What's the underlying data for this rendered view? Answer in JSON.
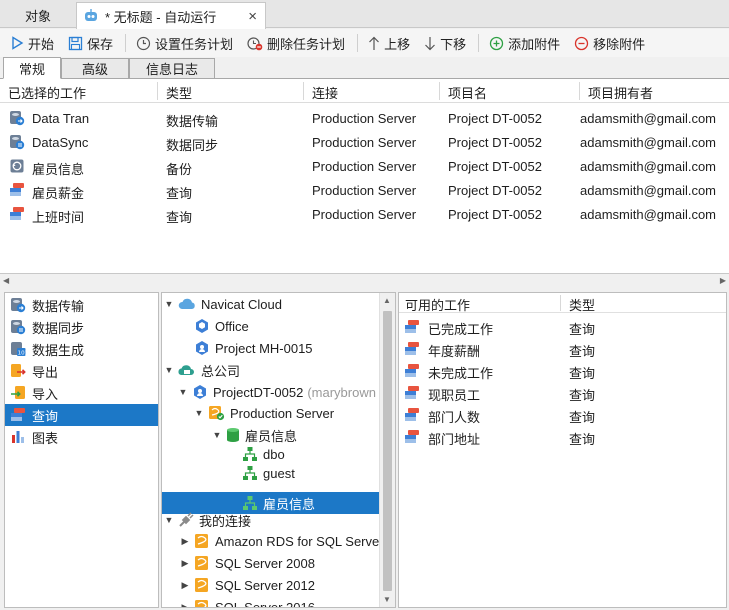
{
  "tabs": {
    "objects": "对象",
    "document": "* 无标题 - 自动运行",
    "close": "×"
  },
  "toolbar": {
    "start": "开始",
    "save": "保存",
    "set_schedule": "设置任务计划",
    "delete_schedule": "删除任务计划",
    "move_up": "上移",
    "move_down": "下移",
    "add_attachment": "添加附件",
    "remove_attachment": "移除附件"
  },
  "subtabs": [
    "常规",
    "高级",
    "信息日志"
  ],
  "jobs": {
    "columns": [
      "已选择的工作",
      "类型",
      "连接",
      "项目名",
      "项目拥有者"
    ],
    "rows": [
      {
        "name": "Data Tran",
        "type": "数据传输",
        "connection": "Production Server",
        "project": "Project DT-0052",
        "owner": "adamsmith@gmail.com",
        "icon": "data-transfer-icon"
      },
      {
        "name": "DataSync",
        "type": "数据同步",
        "connection": "Production Server",
        "project": "Project DT-0052",
        "owner": "adamsmith@gmail.com",
        "icon": "data-sync-icon"
      },
      {
        "name": "雇员信息",
        "type": "备份",
        "connection": "Production Server",
        "project": "Project DT-0052",
        "owner": "adamsmith@gmail.com",
        "icon": "backup-icon"
      },
      {
        "name": "雇员薪金",
        "type": "查询",
        "connection": "Production Server",
        "project": "Project DT-0052",
        "owner": "adamsmith@gmail.com",
        "icon": "query-icon"
      },
      {
        "name": "上班时间",
        "type": "查询",
        "connection": "Production Server",
        "project": "Project DT-0052",
        "owner": "adamsmith@gmail.com",
        "icon": "query-icon"
      }
    ]
  },
  "categories": [
    {
      "label": "数据传输",
      "icon": "data-transfer-icon"
    },
    {
      "label": "数据同步",
      "icon": "data-sync-icon"
    },
    {
      "label": "数据生成",
      "icon": "data-generation-icon"
    },
    {
      "label": "导出",
      "icon": "export-icon"
    },
    {
      "label": "导入",
      "icon": "import-icon"
    },
    {
      "label": "查询",
      "icon": "query-icon",
      "selected": true
    },
    {
      "label": "图表",
      "icon": "chart-icon"
    }
  ],
  "tree": {
    "navicat_cloud": "Navicat Cloud",
    "office": "Office",
    "project_mh": "Project MH-0015",
    "company": "总公司",
    "project_dt": "ProjectDT-0052",
    "project_dt_owner": "(marybrown",
    "production_server": "Production Server",
    "db_employee": "雇员信息",
    "schema_dbo": "dbo",
    "schema_guest": "guest",
    "schema_employee": "雇员信息",
    "my_connections": "我的连接",
    "conn1": "Amazon RDS for SQL Server",
    "conn2": "SQL Server 2008",
    "conn3": "SQL Server 2012",
    "conn4": "SQL Server 2016"
  },
  "available": {
    "columns": [
      "可用的工作",
      "类型"
    ],
    "rows": [
      {
        "name": "已完成工作",
        "type": "查询"
      },
      {
        "name": "年度薪酬",
        "type": "查询"
      },
      {
        "name": "未完成工作",
        "type": "查询"
      },
      {
        "name": "现职员工",
        "type": "查询"
      },
      {
        "name": "部门人数",
        "type": "查询"
      },
      {
        "name": "部门地址",
        "type": "查询"
      }
    ]
  },
  "colors": {
    "selection": "#1c78c7",
    "accent_green": "#2ea043",
    "accent_red": "#d9342b",
    "query_red": "#e8543f",
    "query_blue": "#3d7fd6"
  }
}
